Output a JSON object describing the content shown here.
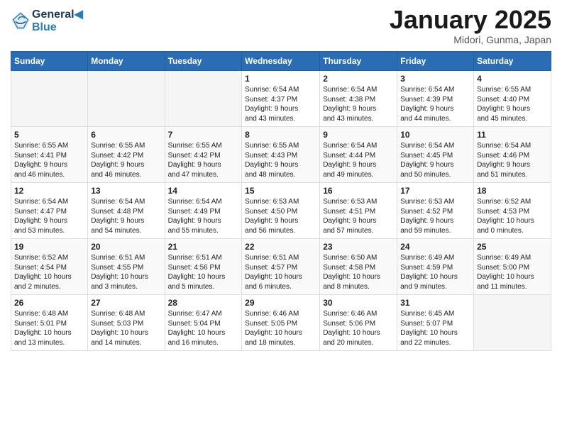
{
  "header": {
    "logo_line1": "General",
    "logo_line2": "Blue",
    "month_title": "January 2025",
    "location": "Midori, Gunma, Japan"
  },
  "days_of_week": [
    "Sunday",
    "Monday",
    "Tuesday",
    "Wednesday",
    "Thursday",
    "Friday",
    "Saturday"
  ],
  "weeks": [
    [
      {
        "day": "",
        "info": ""
      },
      {
        "day": "",
        "info": ""
      },
      {
        "day": "",
        "info": ""
      },
      {
        "day": "1",
        "info": "Sunrise: 6:54 AM\nSunset: 4:37 PM\nDaylight: 9 hours\nand 43 minutes."
      },
      {
        "day": "2",
        "info": "Sunrise: 6:54 AM\nSunset: 4:38 PM\nDaylight: 9 hours\nand 43 minutes."
      },
      {
        "day": "3",
        "info": "Sunrise: 6:54 AM\nSunset: 4:39 PM\nDaylight: 9 hours\nand 44 minutes."
      },
      {
        "day": "4",
        "info": "Sunrise: 6:55 AM\nSunset: 4:40 PM\nDaylight: 9 hours\nand 45 minutes."
      }
    ],
    [
      {
        "day": "5",
        "info": "Sunrise: 6:55 AM\nSunset: 4:41 PM\nDaylight: 9 hours\nand 46 minutes."
      },
      {
        "day": "6",
        "info": "Sunrise: 6:55 AM\nSunset: 4:42 PM\nDaylight: 9 hours\nand 46 minutes."
      },
      {
        "day": "7",
        "info": "Sunrise: 6:55 AM\nSunset: 4:42 PM\nDaylight: 9 hours\nand 47 minutes."
      },
      {
        "day": "8",
        "info": "Sunrise: 6:55 AM\nSunset: 4:43 PM\nDaylight: 9 hours\nand 48 minutes."
      },
      {
        "day": "9",
        "info": "Sunrise: 6:54 AM\nSunset: 4:44 PM\nDaylight: 9 hours\nand 49 minutes."
      },
      {
        "day": "10",
        "info": "Sunrise: 6:54 AM\nSunset: 4:45 PM\nDaylight: 9 hours\nand 50 minutes."
      },
      {
        "day": "11",
        "info": "Sunrise: 6:54 AM\nSunset: 4:46 PM\nDaylight: 9 hours\nand 51 minutes."
      }
    ],
    [
      {
        "day": "12",
        "info": "Sunrise: 6:54 AM\nSunset: 4:47 PM\nDaylight: 9 hours\nand 53 minutes."
      },
      {
        "day": "13",
        "info": "Sunrise: 6:54 AM\nSunset: 4:48 PM\nDaylight: 9 hours\nand 54 minutes."
      },
      {
        "day": "14",
        "info": "Sunrise: 6:54 AM\nSunset: 4:49 PM\nDaylight: 9 hours\nand 55 minutes."
      },
      {
        "day": "15",
        "info": "Sunrise: 6:53 AM\nSunset: 4:50 PM\nDaylight: 9 hours\nand 56 minutes."
      },
      {
        "day": "16",
        "info": "Sunrise: 6:53 AM\nSunset: 4:51 PM\nDaylight: 9 hours\nand 57 minutes."
      },
      {
        "day": "17",
        "info": "Sunrise: 6:53 AM\nSunset: 4:52 PM\nDaylight: 9 hours\nand 59 minutes."
      },
      {
        "day": "18",
        "info": "Sunrise: 6:52 AM\nSunset: 4:53 PM\nDaylight: 10 hours\nand 0 minutes."
      }
    ],
    [
      {
        "day": "19",
        "info": "Sunrise: 6:52 AM\nSunset: 4:54 PM\nDaylight: 10 hours\nand 2 minutes."
      },
      {
        "day": "20",
        "info": "Sunrise: 6:51 AM\nSunset: 4:55 PM\nDaylight: 10 hours\nand 3 minutes."
      },
      {
        "day": "21",
        "info": "Sunrise: 6:51 AM\nSunset: 4:56 PM\nDaylight: 10 hours\nand 5 minutes."
      },
      {
        "day": "22",
        "info": "Sunrise: 6:51 AM\nSunset: 4:57 PM\nDaylight: 10 hours\nand 6 minutes."
      },
      {
        "day": "23",
        "info": "Sunrise: 6:50 AM\nSunset: 4:58 PM\nDaylight: 10 hours\nand 8 minutes."
      },
      {
        "day": "24",
        "info": "Sunrise: 6:49 AM\nSunset: 4:59 PM\nDaylight: 10 hours\nand 9 minutes."
      },
      {
        "day": "25",
        "info": "Sunrise: 6:49 AM\nSunset: 5:00 PM\nDaylight: 10 hours\nand 11 minutes."
      }
    ],
    [
      {
        "day": "26",
        "info": "Sunrise: 6:48 AM\nSunset: 5:01 PM\nDaylight: 10 hours\nand 13 minutes."
      },
      {
        "day": "27",
        "info": "Sunrise: 6:48 AM\nSunset: 5:03 PM\nDaylight: 10 hours\nand 14 minutes."
      },
      {
        "day": "28",
        "info": "Sunrise: 6:47 AM\nSunset: 5:04 PM\nDaylight: 10 hours\nand 16 minutes."
      },
      {
        "day": "29",
        "info": "Sunrise: 6:46 AM\nSunset: 5:05 PM\nDaylight: 10 hours\nand 18 minutes."
      },
      {
        "day": "30",
        "info": "Sunrise: 6:46 AM\nSunset: 5:06 PM\nDaylight: 10 hours\nand 20 minutes."
      },
      {
        "day": "31",
        "info": "Sunrise: 6:45 AM\nSunset: 5:07 PM\nDaylight: 10 hours\nand 22 minutes."
      },
      {
        "day": "",
        "info": ""
      }
    ]
  ]
}
